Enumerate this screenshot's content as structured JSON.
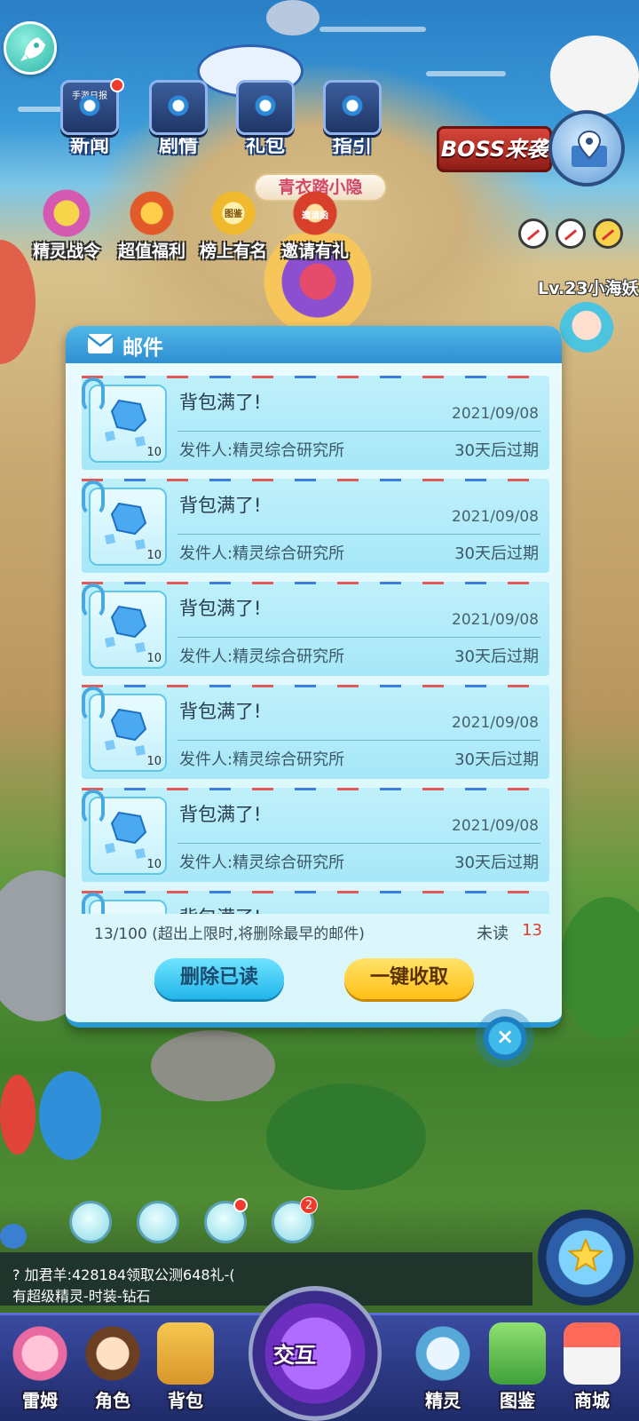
{
  "top_icons": [
    {
      "label": "新闻",
      "name": "news"
    },
    {
      "label": "剧情",
      "name": "story"
    },
    {
      "label": "礼包",
      "name": "gift-pack"
    },
    {
      "label": "指引",
      "name": "guide"
    }
  ],
  "top_icons_tile_text": "手游日报",
  "boss_button": "BOSS来袭",
  "activity_icons": [
    {
      "label": "精灵战令",
      "name": "battle-pass"
    },
    {
      "label": "超值福利",
      "name": "value-welfare"
    },
    {
      "label": "榜上有名",
      "name": "leaderboard"
    },
    {
      "label": "邀请有礼",
      "name": "invite-reward"
    }
  ],
  "ranking_plaque": "图鉴",
  "invite_card": "邀请函",
  "guild_banner": "青衣踏小隐",
  "level_text": "Lv.23小海妖",
  "mail_dialog": {
    "title": "邮件",
    "items": [
      {
        "subject": "背包满了!",
        "date": "2021/09/08",
        "sender": "发件人:精灵综合研究所",
        "expire": "30天后过期",
        "qty": "10"
      },
      {
        "subject": "背包满了!",
        "date": "2021/09/08",
        "sender": "发件人:精灵综合研究所",
        "expire": "30天后过期",
        "qty": "10"
      },
      {
        "subject": "背包满了!",
        "date": "2021/09/08",
        "sender": "发件人:精灵综合研究所",
        "expire": "30天后过期",
        "qty": "10"
      },
      {
        "subject": "背包满了!",
        "date": "2021/09/08",
        "sender": "发件人:精灵综合研究所",
        "expire": "30天后过期",
        "qty": "10"
      },
      {
        "subject": "背包满了!",
        "date": "2021/09/08",
        "sender": "发件人:精灵综合研究所",
        "expire": "30天后过期",
        "qty": "10"
      },
      {
        "subject": "背包满了!",
        "date": "",
        "sender": "",
        "expire": "",
        "qty": ""
      }
    ],
    "capacity_info": "13/100 (超出上限时,将删除最早的邮件)",
    "unread_label": "未读",
    "unread_count": "13",
    "delete_read_button": "删除已读",
    "collect_all_button": "一键收取",
    "close_symbol": "×"
  },
  "tool_badge_count": "2",
  "chat": {
    "line1": "? 加君羊:428184领取公测648礼-(",
    "line2": "有超级精灵-时装-钻石"
  },
  "bottom_nav": [
    {
      "label": "雷姆",
      "name": "leimu"
    },
    {
      "label": "角色",
      "name": "role"
    },
    {
      "label": "背包",
      "name": "backpack"
    },
    {
      "label": "精灵",
      "name": "spirit"
    },
    {
      "label": "图鉴",
      "name": "codex"
    },
    {
      "label": "商城",
      "name": "shop"
    }
  ],
  "center_button": "交互",
  "colors": {
    "accent_blue": "#2e8fd2",
    "collect_yellow": "#ffbf16",
    "unread_red": "#e23a2c"
  }
}
